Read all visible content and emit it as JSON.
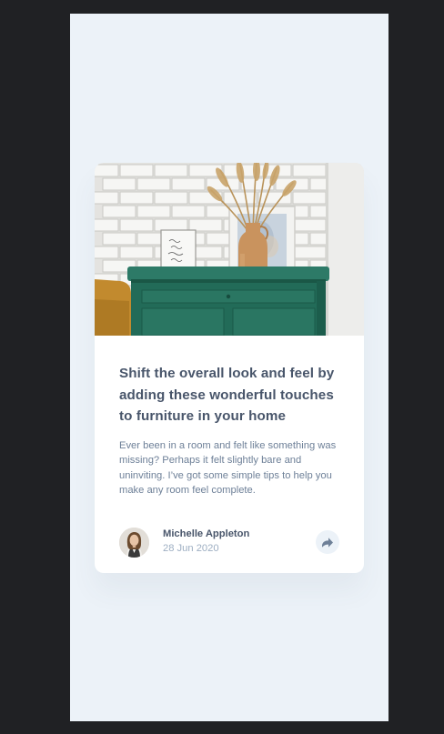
{
  "colors": {
    "page_background": "#ECF2F8",
    "card_background": "#FFFFFF",
    "heading": "#48556A",
    "body_text": "#6E8098",
    "muted_text": "#9DAEC2",
    "dark_frame": "#202124"
  },
  "card": {
    "image_alt": "drawers",
    "title": "Shift the overall look and feel by adding these wonderful touches to furniture in your home",
    "excerpt": "Ever been in a room and felt like something was missing? Perhaps it felt slightly bare and uninviting. I’ve got some simple tips to help you make any room feel complete.",
    "author": {
      "name": "Michelle Appleton",
      "date": "28 Jun 2020",
      "avatar_icon": "avatar-portrait"
    },
    "share": {
      "icon": "share-icon"
    }
  }
}
